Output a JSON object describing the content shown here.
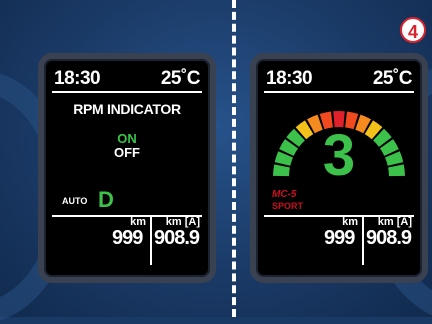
{
  "left_display": {
    "time": "18:30",
    "temperature": "25˚C",
    "title": "RPM INDICATOR",
    "option_on": "ON",
    "option_off": "OFF",
    "mode_label": "AUTO",
    "gear": "D",
    "odometer": {
      "unit": "km",
      "value": "999"
    },
    "trip": {
      "unit": "km [A]",
      "value": "908.9"
    }
  },
  "right_display": {
    "time": "18:30",
    "temperature": "25˚C",
    "gear": "3",
    "brand": "MC-5",
    "mode": "SPORT",
    "odometer": {
      "unit": "km",
      "value": "999"
    },
    "trip": {
      "unit": "km [A]",
      "value": "908.9"
    }
  },
  "step_badge": "4",
  "colors": {
    "accent_green": "#3cc24a",
    "accent_red": "#c8101e",
    "background": "#1a3a66"
  }
}
